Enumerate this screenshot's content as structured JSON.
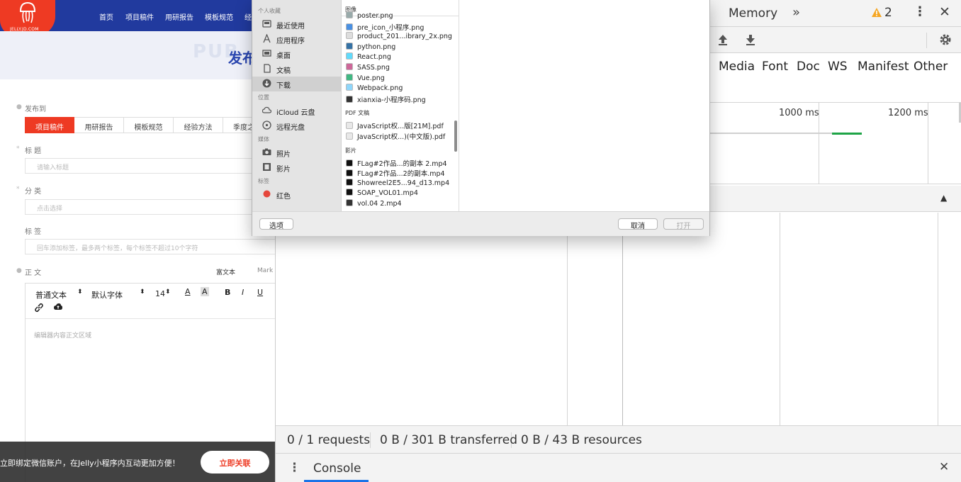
{
  "site": {
    "logo_text": "JELLY.JD.COM",
    "nav": [
      "首页",
      "项目稿件",
      "用研报告",
      "模板规范",
      "经"
    ],
    "hero_title": "发布",
    "hero_ghost": "PUB",
    "publish_label": "发布到",
    "category_tabs": [
      "项目稿件",
      "用研报告",
      "模板规范",
      "经验方法",
      "季度之"
    ],
    "title_label": "标 题",
    "title_placeholder": "请输入标题",
    "category_label": "分 类",
    "category_placeholder": "点击选择",
    "tag_label": "标 签",
    "tag_placeholder": "回车添加标签，最多两个标签，每个标签不超过10个字符",
    "body_label": "正 文",
    "mode_rich": "富文本",
    "mode_md": "Mark",
    "editor": {
      "text_style": "普通文本",
      "font": "默认字体",
      "size": "14",
      "placeholder": "编辑器内容正文区域"
    },
    "banner_text": "立即绑定微信账户，在Jelly小程序内互动更加方便！",
    "banner_button": "立即关联"
  },
  "dialog": {
    "sidebar": [
      {
        "type": "header",
        "text": "个人收藏"
      },
      {
        "type": "item",
        "text": "最近使用",
        "icon": "recent-icon"
      },
      {
        "type": "item",
        "text": "应用程序",
        "icon": "applications-icon"
      },
      {
        "type": "item",
        "text": "桌面",
        "icon": "desktop-icon"
      },
      {
        "type": "item",
        "text": "文稿",
        "icon": "documents-icon"
      },
      {
        "type": "item",
        "text": "下载",
        "icon": "downloads-icon",
        "selected": true
      },
      {
        "type": "header",
        "text": "位置"
      },
      {
        "type": "item",
        "text": "iCloud 云盘",
        "icon": "cloud-icon"
      },
      {
        "type": "item",
        "text": "远程光盘",
        "icon": "disc-icon"
      },
      {
        "type": "header",
        "text": "媒体"
      },
      {
        "type": "item",
        "text": "照片",
        "icon": "camera-icon"
      },
      {
        "type": "item",
        "text": "影片",
        "icon": "film-icon"
      },
      {
        "type": "header",
        "text": "标签"
      },
      {
        "type": "item",
        "text": "红色",
        "icon": "red-tag-icon"
      }
    ],
    "sections": [
      {
        "title": "图像",
        "files": [
          {
            "name": "poster.png",
            "color": "#9aa"
          },
          {
            "name": "pre_icon_小程序.png",
            "color": "#4a90e2"
          },
          {
            "name": "product_201...ibrary_2x.png",
            "color": "#ddd"
          },
          {
            "name": "python.png",
            "color": "#3572a5"
          },
          {
            "name": "React.png",
            "color": "#61dafb"
          },
          {
            "name": "SASS.png",
            "color": "#cd6799"
          },
          {
            "name": "Vue.png",
            "color": "#41b883"
          },
          {
            "name": "Webpack.png",
            "color": "#8ed6fb"
          },
          {
            "name": "xianxia-小程序码.png",
            "color": "#333"
          }
        ]
      },
      {
        "title": "PDF 文稿",
        "files": [
          {
            "name": "JavaScript权...版[21M].pdf",
            "color": "#e8e8e8"
          },
          {
            "name": "JavaScript权...)(中文版).pdf",
            "color": "#e8e8e8"
          }
        ]
      },
      {
        "title": "影片",
        "files": [
          {
            "name": "FLag#2作品...的副本 2.mp4",
            "color": "#111"
          },
          {
            "name": "FLag#2作品...2的副本.mp4",
            "color": "#111"
          },
          {
            "name": "Showreel2E5...94_d13.mp4",
            "color": "#111"
          },
          {
            "name": "SOAP_VOL01.mp4",
            "color": "#111"
          },
          {
            "name": "vol.04 2.mp4",
            "color": "#333"
          }
        ]
      }
    ],
    "options_button": "选项",
    "cancel_button": "取消",
    "open_button": "打开"
  },
  "devtools": {
    "panel_tab": "Memory",
    "warning_count": "2",
    "filter_types": [
      "Media",
      "Font",
      "Doc",
      "WS",
      "Manifest",
      "Other"
    ],
    "timeline_ticks": [
      "1000 ms",
      "1200 ms"
    ],
    "requests": "0 / 1 requests",
    "transferred": "0 B / 301 B transferred",
    "resources": "0 B / 43 B resources",
    "drawer_tab": "Console"
  },
  "colors": {
    "brand_red": "#ee3a23",
    "nav_blue": "#213a9e",
    "timing_green": "#1ea446"
  }
}
